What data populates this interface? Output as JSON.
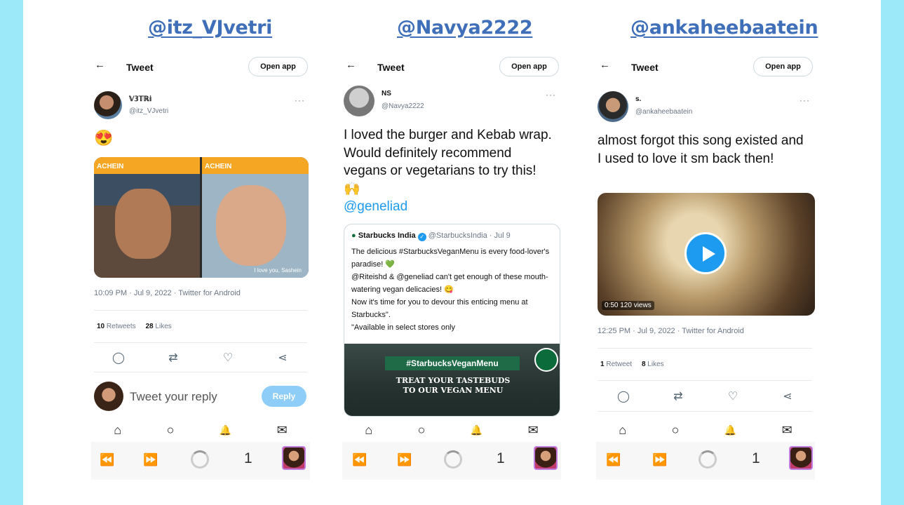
{
  "panels": [
    {
      "handle": "@itz_VJvetri",
      "topbar": {
        "back": "←",
        "title": "Tweet",
        "open_app": "Open app"
      },
      "author": {
        "name": "𝕍𝟛𝕋ℝ𝕚",
        "username": "@itz_VJvetri"
      },
      "body": "😍",
      "image_caption_left": "ACHEIN",
      "image_caption_right": "ACHEIN",
      "image_subtitle": "I love you, Sashein",
      "meta": "10:09 PM · Jul 9, 2022 · Twitter for Android",
      "stats": {
        "retweets_count": "10",
        "retweets_label": "Retweets",
        "likes_count": "28",
        "likes_label": "Likes"
      },
      "reply_placeholder": "Tweet your reply",
      "reply_button": "Reply",
      "tabcount": "1"
    },
    {
      "handle": "@Navya2222",
      "topbar": {
        "back": "←",
        "title": "Tweet",
        "open_app": "Open app"
      },
      "author": {
        "name": "NS",
        "username": "@Navya2222"
      },
      "body": "I loved the burger and Kebab wrap. Would definitely recommend vegans or vegetarians to try this! 🙌",
      "mention": "@geneliad",
      "quote": {
        "name": "Starbucks India",
        "username": "@StarbucksIndia",
        "date": "· Jul 9",
        "lines": [
          "The delicious #StarbucksVeganMenu is every food-lover's paradise! 💚",
          "@Riteishd & @geneliad can't get enough of these mouth-watering vegan delicacies! 😋",
          "Now it's time for you to devour this enticing menu at Starbucks\".",
          "\"Available in select stores only"
        ],
        "banner": "#StarbucksVeganMenu",
        "sub_line1": "TREAT YOUR TASTEBUDS",
        "sub_line2": "TO OUR VEGAN MENU"
      },
      "tabcount": "1"
    },
    {
      "handle": "@ankaheebaatein",
      "topbar": {
        "back": "←",
        "title": "Tweet",
        "open_app": "Open app"
      },
      "author": {
        "name": "s.",
        "username": "@ankaheebaatein"
      },
      "body": "almost forgot this song existed and I used to love it sm back then!",
      "video": {
        "time": "0:50",
        "views": "120 views"
      },
      "meta": "12:25 PM · Jul 9, 2022 · Twitter for Android",
      "stats": {
        "retweets_count": "1",
        "retweets_label": "Retweet",
        "likes_count": "8",
        "likes_label": "Likes"
      },
      "tabcount": "1"
    }
  ],
  "icons": {
    "more": "···",
    "reply": "◯",
    "retweet": "⇄",
    "like": "♡",
    "share": "⋖",
    "home": "⌂",
    "search": "○",
    "bell": "🔔",
    "mail": "✉",
    "rewind": "⏪",
    "forward": "⏩"
  },
  "colors": {
    "accent": "#1d9bf0",
    "edge": "#9be9f9",
    "handle": "#3f6fb8"
  }
}
